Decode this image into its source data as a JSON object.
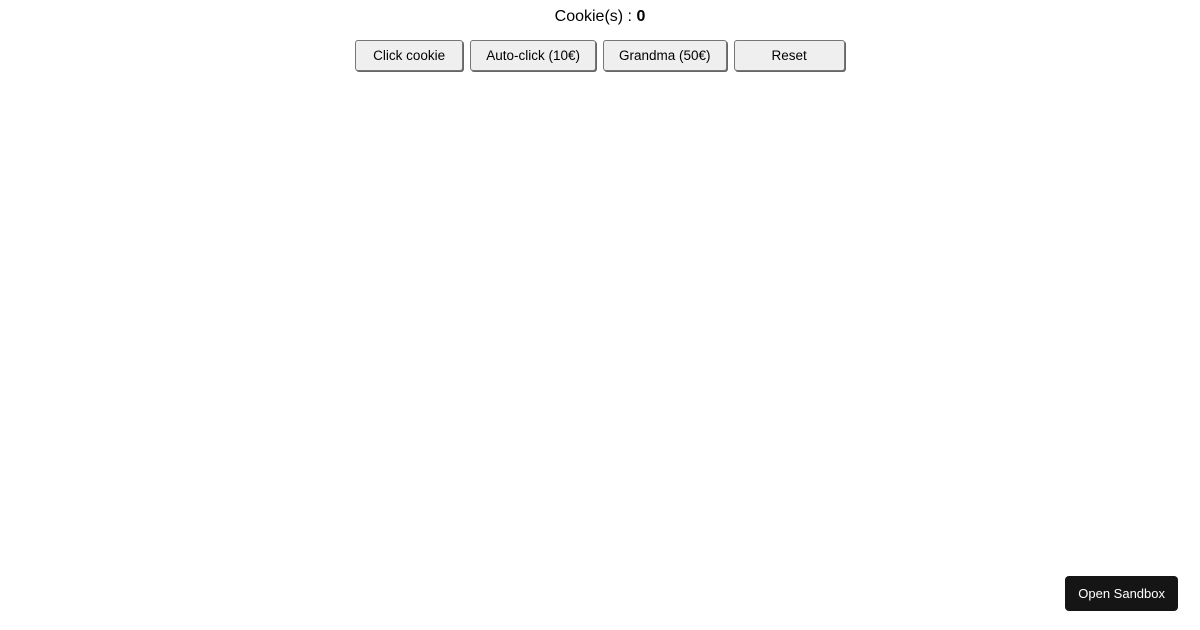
{
  "counter": {
    "label": "Cookie(s) : ",
    "value": "0"
  },
  "buttons": {
    "click": "Click cookie",
    "autoclick": "Auto-click (10€)",
    "grandma": "Grandma (50€)",
    "reset": "Reset"
  },
  "sandbox": {
    "open_label": "Open Sandbox"
  }
}
